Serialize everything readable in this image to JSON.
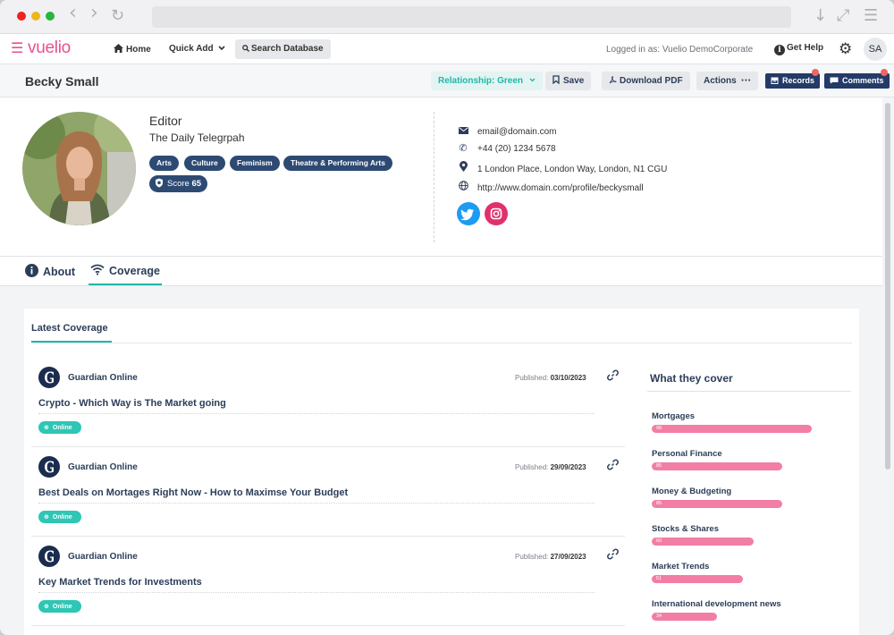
{
  "browser": {
    "back_glyph": "‹",
    "forward_glyph": "›",
    "reload_glyph": "↻",
    "download_glyph": "↓",
    "expand_glyph": "⤢",
    "menu_glyph": "☰"
  },
  "header": {
    "logo": "vuelio",
    "nav": {
      "home": "Home",
      "quick_add": "Quick Add",
      "search_database": "Search Database"
    },
    "logged_in": "Logged in as: Vuelio DemoCorporate",
    "get_help": "Get Help",
    "user_initials": "SA"
  },
  "titlebar": {
    "name": "Becky Small",
    "relationship": "Relationship: Green",
    "save": "Save",
    "download_pdf": "Download PDF",
    "actions": "Actions",
    "records": "Records",
    "comments": "Comments"
  },
  "profile": {
    "role": "Editor",
    "outlet": "The Daily Telegrpah",
    "tags": [
      "Arts",
      "Culture",
      "Feminism",
      "Theatre & Performing Arts"
    ],
    "score_label": "Score",
    "score_value": "65",
    "contact": {
      "email": "email@domain.com",
      "phone": "+44 (20) 1234 5678",
      "address": "1 London Place, London Way, London, N1 CGU",
      "website": "http://www.domain.com/profile/beckysmall"
    },
    "social": [
      "twitter-icon",
      "instagram-icon"
    ]
  },
  "tabs": {
    "about": "About",
    "coverage": "Coverage",
    "active": "Coverage"
  },
  "coverage": {
    "title": "Latest Coverage",
    "published_label": "Published:",
    "articles": [
      {
        "source": "Guardian Online",
        "date": "03/10/2023",
        "title": "Crypto - Which Way is The Market going",
        "type": "Online"
      },
      {
        "source": "Guardian Online",
        "date": "29/09/2023",
        "title": "Best Deals on Mortages Right Now - How to Maximse Your Budget",
        "type": "Online"
      },
      {
        "source": "Guardian Online",
        "date": "27/09/2023",
        "title": "Key Market Trends for Investments",
        "type": "Online"
      }
    ],
    "what_they_cover": {
      "title": "What they cover",
      "topics": [
        {
          "label": "Mortgages",
          "value": "98"
        },
        {
          "label": "Personal Finance",
          "value": "85"
        },
        {
          "label": "Money & Budgeting",
          "value": "85"
        },
        {
          "label": "Stocks & Shares",
          "value": "60"
        },
        {
          "label": "Market Trends",
          "value": "51"
        },
        {
          "label": "International development news",
          "value": "34"
        }
      ]
    }
  },
  "colors": {
    "brand": "#e9508f",
    "accent": "#1fb7a8",
    "navy": "#243a67",
    "bar": "#f27ea5",
    "online_pill": "#2ec6b5"
  }
}
